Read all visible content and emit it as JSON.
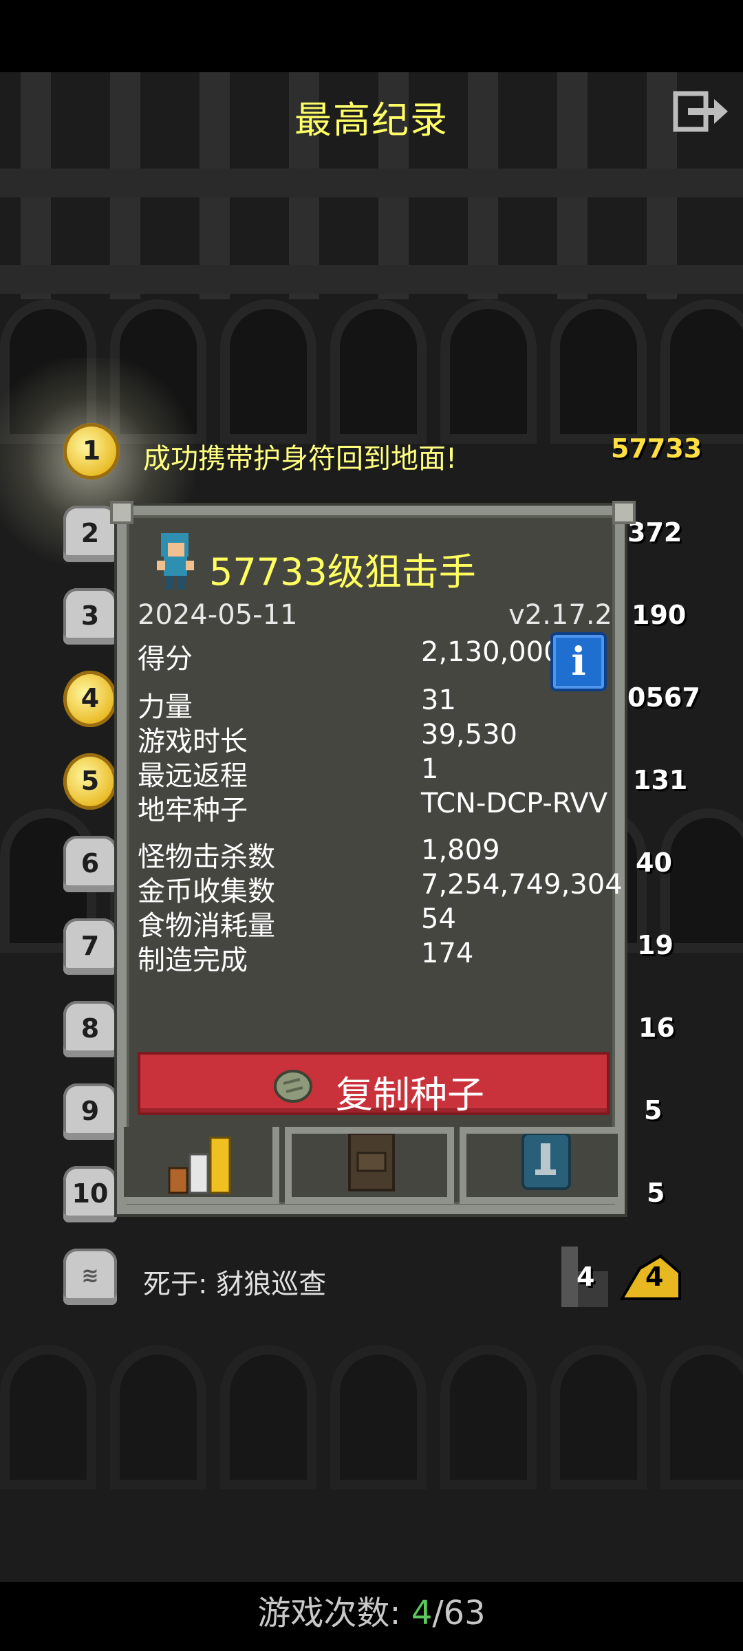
{
  "header": {
    "title": "最高纪录",
    "exit_icon": "exit-icon"
  },
  "top_entry": {
    "rank": "1",
    "text": "成功携带护身符回到地面!",
    "score": "57733"
  },
  "side_scores": [
    "372",
    "190",
    "0567",
    "131",
    "40",
    "19",
    "16",
    "5",
    "5",
    "4"
  ],
  "ranks": [
    "2",
    "3",
    "4",
    "5",
    "6",
    "7",
    "8",
    "9",
    "10"
  ],
  "bottom_entry": {
    "text": "死于:  豺狼巡查",
    "depth": "4",
    "score": "4"
  },
  "popup": {
    "hero_title": "57733级狙击手",
    "date": "2024-05-11",
    "version": "v2.17.2",
    "stats": [
      {
        "label": "得分",
        "value": "2,130,000"
      },
      {
        "label": "力量",
        "value": "31"
      },
      {
        "label": "游戏时长",
        "value": "39,530"
      },
      {
        "label": "最远返程",
        "value": "1"
      },
      {
        "label": "地牢种子",
        "value": "TCN-DCP-RVV"
      },
      {
        "label": "怪物击杀数",
        "value": "1,809"
      },
      {
        "label": "金币收集数",
        "value": "7,254,749,304"
      },
      {
        "label": "食物消耗量",
        "value": "54"
      },
      {
        "label": "制造完成",
        "value": "174"
      }
    ],
    "info_label": "i",
    "copy_seed_label": "复制种子",
    "tabs": [
      "stats-icon",
      "backpack-icon",
      "badge-icon"
    ]
  },
  "footer": {
    "label": "游戏次数:  ",
    "current": "4",
    "total": "/63"
  },
  "colors": {
    "accent_yellow": "#ffff66",
    "red_button": "#c9323a",
    "info_blue": "#1f6fd1",
    "green": "#5dc85d"
  }
}
